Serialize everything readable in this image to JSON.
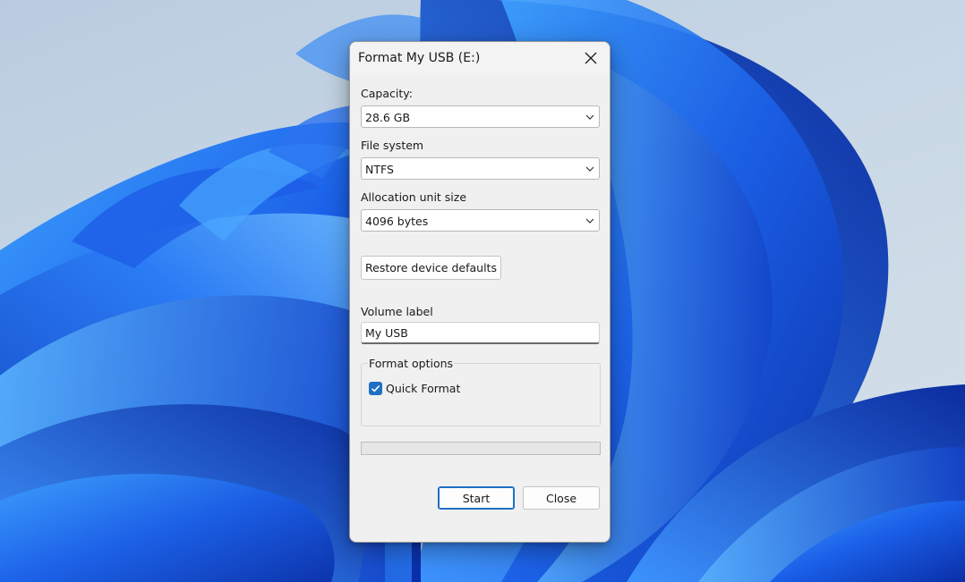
{
  "dialog": {
    "title": "Format My USB (E:)",
    "capacity": {
      "label": "Capacity:",
      "value": "28.6 GB"
    },
    "file_system": {
      "label": "File system",
      "value": "NTFS"
    },
    "allocation_unit_size": {
      "label": "Allocation unit size",
      "value": "4096 bytes"
    },
    "restore_defaults_label": "Restore device defaults",
    "volume_label": {
      "label": "Volume label",
      "value": "My USB"
    },
    "format_options": {
      "legend": "Format options",
      "quick_format": {
        "label": "Quick Format",
        "checked": true
      }
    },
    "progress": 0,
    "start_label": "Start",
    "close_label": "Close"
  },
  "colors": {
    "accent": "#1f6fc5",
    "dialog_bg": "#f0f0f0",
    "wallpaper_blue": "#1f62e0"
  },
  "icons": [
    "close-icon",
    "chevron-down-icon",
    "checkmark-icon"
  ]
}
